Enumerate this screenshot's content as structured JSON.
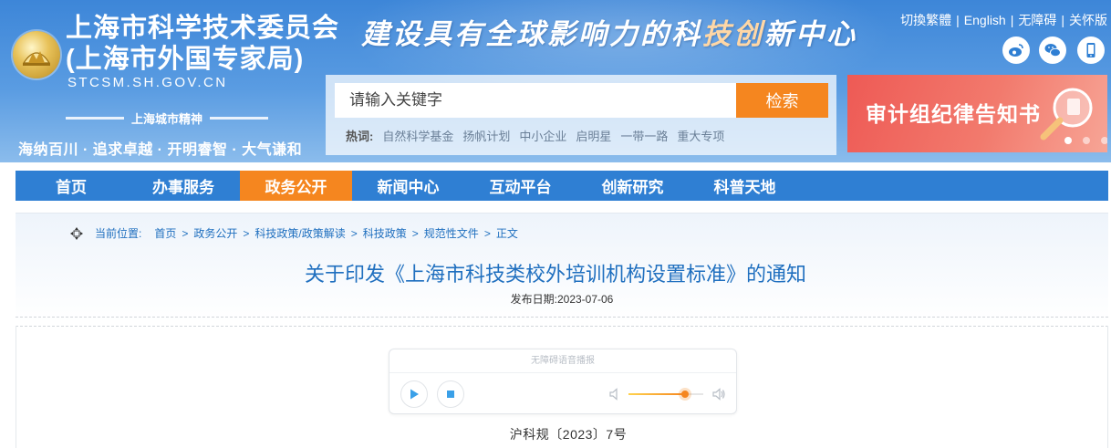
{
  "header": {
    "org_name_line1": "上海市科学技术委员会",
    "org_name_line2": "(上海市外国专家局)",
    "domain": "STCSM.SH.GOV.CN",
    "slogan_part1": "建设具有全球影响力的科",
    "slogan_highlight": "技创",
    "slogan_part2": "新中心",
    "spirit_title": "上海城市精神",
    "spirit_values": "海纳百川 · 追求卓越 · 开明睿智 · 大气谦和",
    "emblem_icon": "city-emblem-icon"
  },
  "toplinks": {
    "traditional": "切換繁體",
    "english": "English",
    "accessibility": "无障碍",
    "elderly": "关怀版",
    "separator": "|"
  },
  "social": [
    {
      "name": "weibo-icon"
    },
    {
      "name": "wechat-icon"
    },
    {
      "name": "mobile-icon"
    }
  ],
  "search": {
    "placeholder": "请输入关键字",
    "button_label": "检索",
    "hot_label": "热词:",
    "hotwords": [
      "自然科学基金",
      "扬帆计划",
      "中小企业",
      "启明星",
      "一带一路",
      "重大专项"
    ]
  },
  "banner": {
    "text": "审计组纪律告知书",
    "slides": 3,
    "active_slide": 1
  },
  "nav": {
    "items": [
      "首页",
      "办事服务",
      "政务公开",
      "新闻中心",
      "互动平台",
      "创新研究",
      "科普天地"
    ],
    "active_index": 2
  },
  "breadcrumb": {
    "label": "当前位置:",
    "items": [
      "首页",
      "政务公开",
      "科技政策/政策解读",
      "科技政策",
      "规范性文件",
      "正文"
    ],
    "arrow": ">"
  },
  "article": {
    "title": "关于印发《上海市科技类校外培训机构设置标准》的通知",
    "date_label": "发布日期:",
    "date": "2023-07-06",
    "doc_number": "沪科规〔2023〕7号"
  },
  "player": {
    "caption": "无障碍语音播报",
    "volume": 0.75
  },
  "colors": {
    "brand_blue": "#2f7fd3",
    "accent_orange": "#f5861f",
    "title_blue": "#1f6fbf",
    "banner_red": "#ee5a55"
  }
}
